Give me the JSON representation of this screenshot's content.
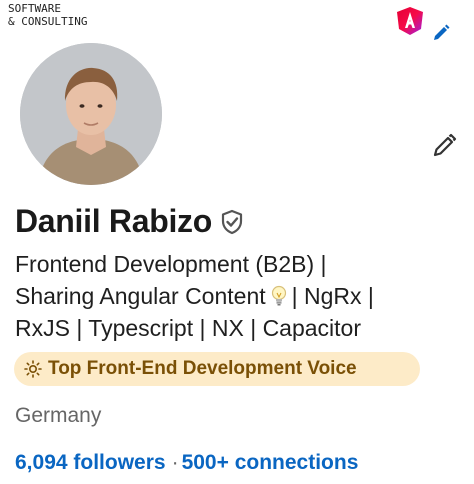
{
  "banner": {
    "company_line1": "SOFTWARE",
    "company_line2": "& CONSULTING",
    "logo_icon": "angular-brand-logo-icon",
    "edit_icon": "pencil-icon"
  },
  "profile": {
    "name": "Daniil Rabizo",
    "verified_icon": "verified-shield-icon",
    "headline_line1": "Frontend Development (B2B) |",
    "headline_line2a": "Sharing Angular Content",
    "headline_bulb_icon": "lightbulb-icon",
    "headline_line2b": "| NgRx |",
    "headline_line3": "RxJS | Typescript | NX | Capacitor",
    "badge_icon": "sun-icon",
    "badge_label": "Top Front-End Development Voice",
    "location": "Germany",
    "followers": "6,094 followers",
    "separator": "·",
    "connections": "500+ connections",
    "edit_icon": "pencil-icon"
  },
  "colors": {
    "link": "#0a66c2",
    "badge_bg": "#fdebc8",
    "badge_text": "#7a5006",
    "muted_text": "#666666"
  }
}
